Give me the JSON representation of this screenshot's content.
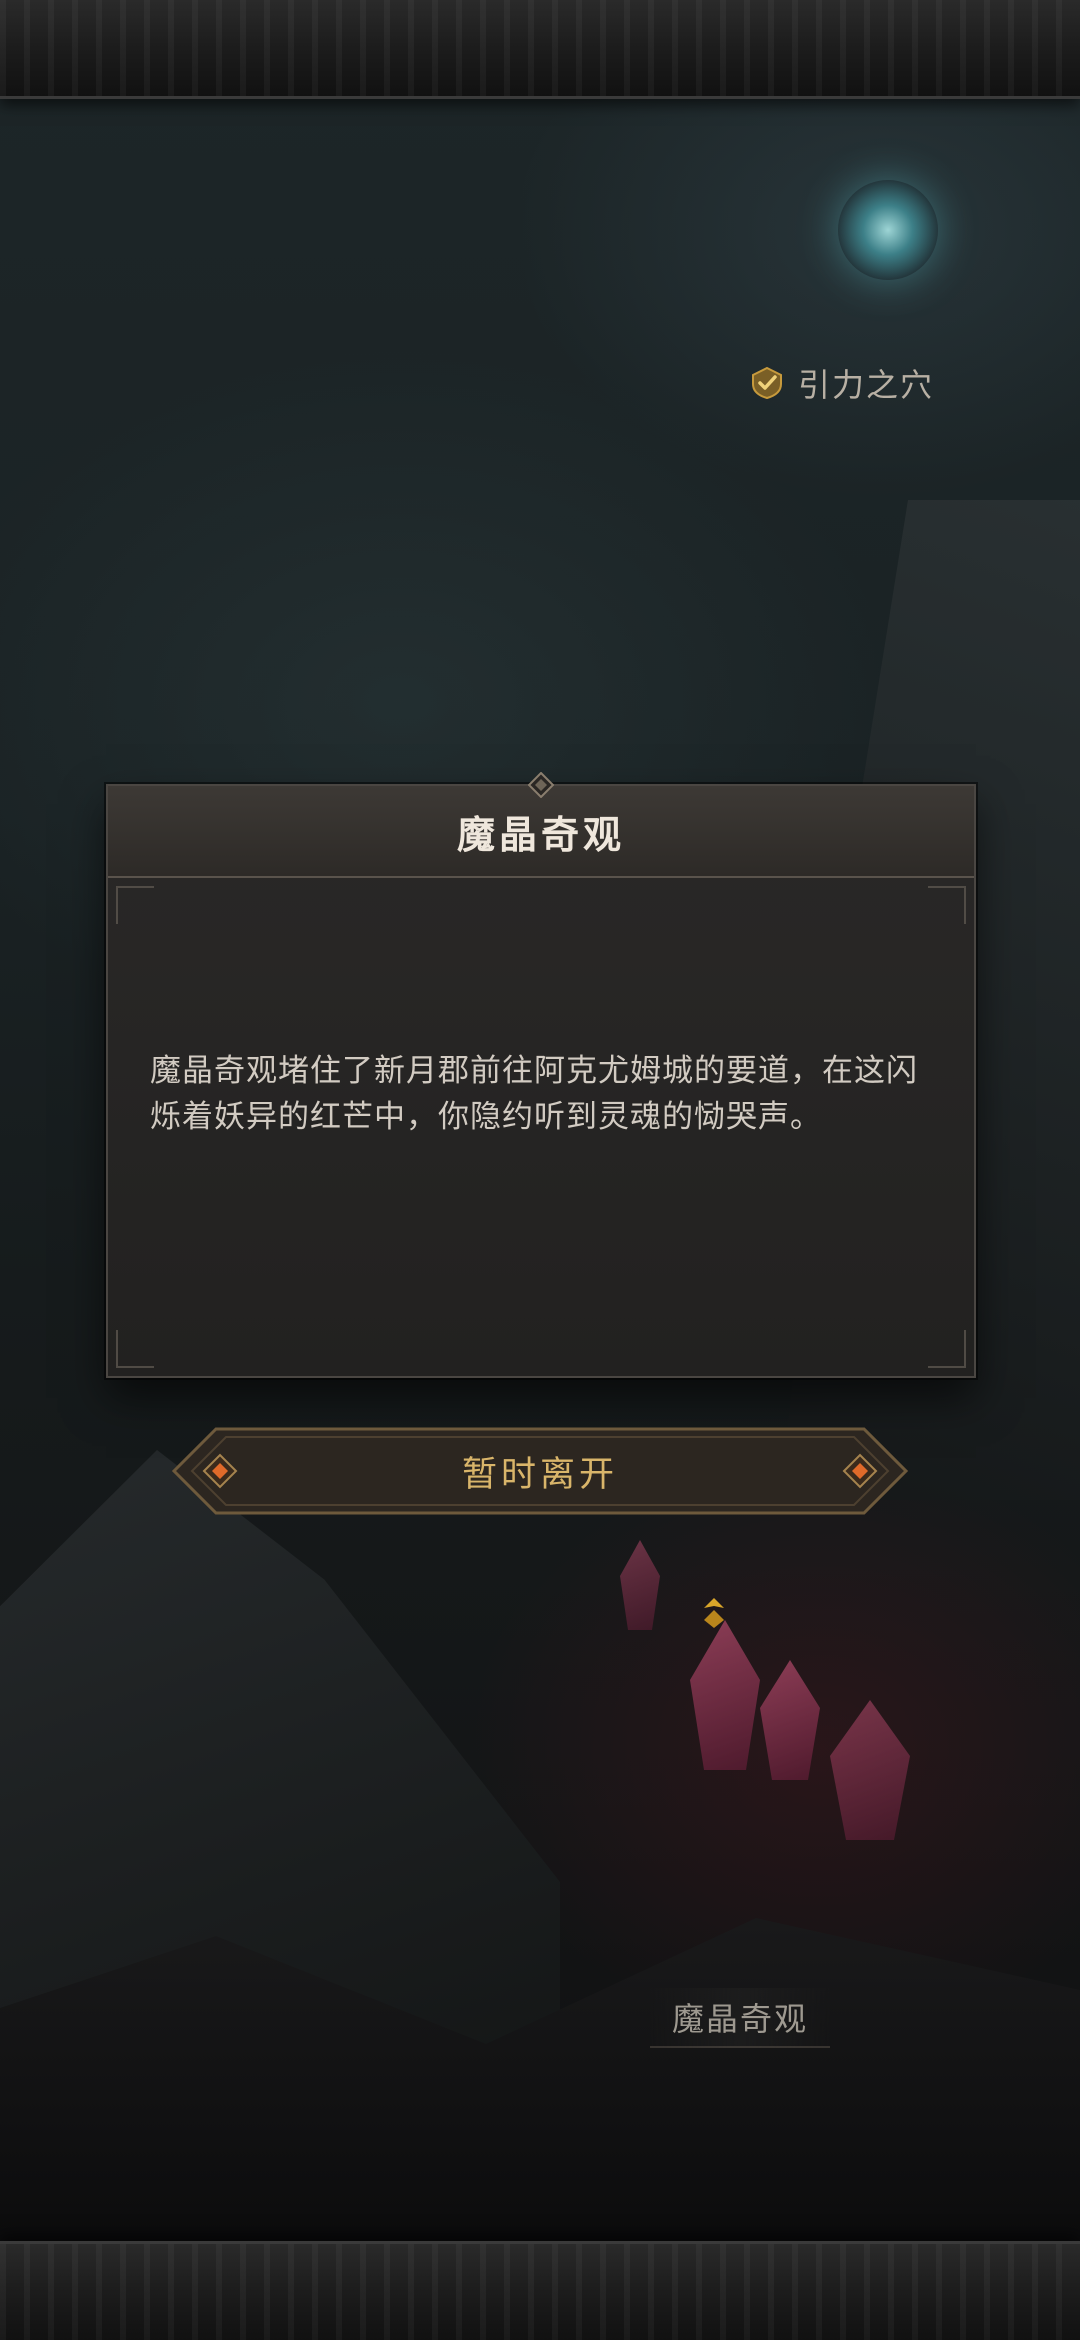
{
  "map": {
    "portal_label": "引力之穴",
    "crystal_label": "魔晶奇观"
  },
  "dialog": {
    "title": "魔晶奇观",
    "body": "魔晶奇观堵住了新月郡前往阿克尤姆城的要道，在这闪烁着妖异的红芒中，你隐约听到灵魂的恸哭声。",
    "leave_button": "暂时离开"
  },
  "icons": {
    "portal_status": "check-shield-icon",
    "crystal_marker": "location-marker-icon",
    "button_ornaments": "diamond-gem-icon"
  },
  "colors": {
    "accent_gold": "#d9b56a",
    "gem_orange": "#e06a2a",
    "portal_cyan": "#6fc5cb",
    "crystal_red": "#b04a6a"
  }
}
